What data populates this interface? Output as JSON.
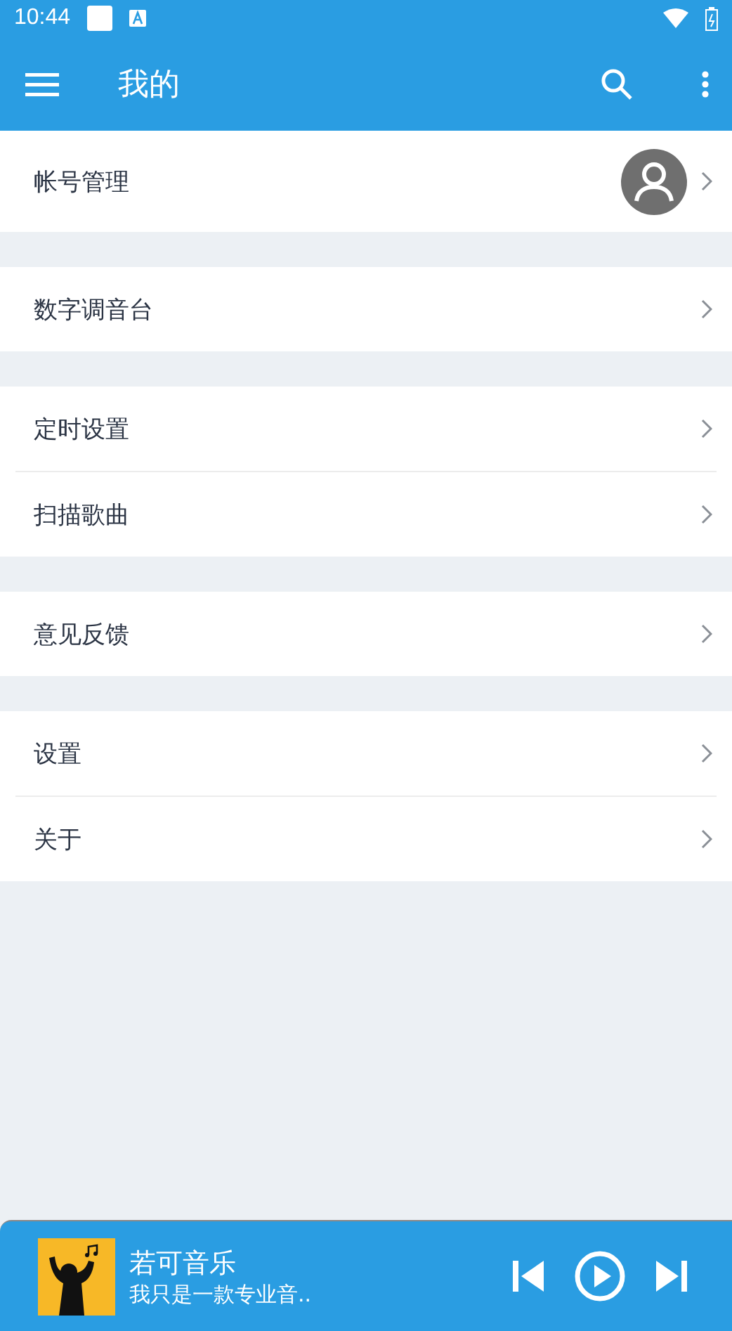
{
  "status_bar": {
    "time": "10:44"
  },
  "app_bar": {
    "title": "我的"
  },
  "groups": [
    {
      "items": [
        {
          "label": "帐号管理",
          "kind": "avatar"
        }
      ]
    },
    {
      "items": [
        {
          "label": "数字调音台",
          "kind": "plain"
        }
      ]
    },
    {
      "items": [
        {
          "label": "定时设置",
          "kind": "plain"
        },
        {
          "label": "扫描歌曲",
          "kind": "plain"
        }
      ]
    },
    {
      "items": [
        {
          "label": "意见反馈",
          "kind": "plain"
        }
      ]
    },
    {
      "items": [
        {
          "label": "设置",
          "kind": "plain"
        },
        {
          "label": "关于",
          "kind": "plain"
        }
      ]
    }
  ],
  "player": {
    "title": "若可音乐",
    "subtitle": "我只是一款专业音.."
  }
}
